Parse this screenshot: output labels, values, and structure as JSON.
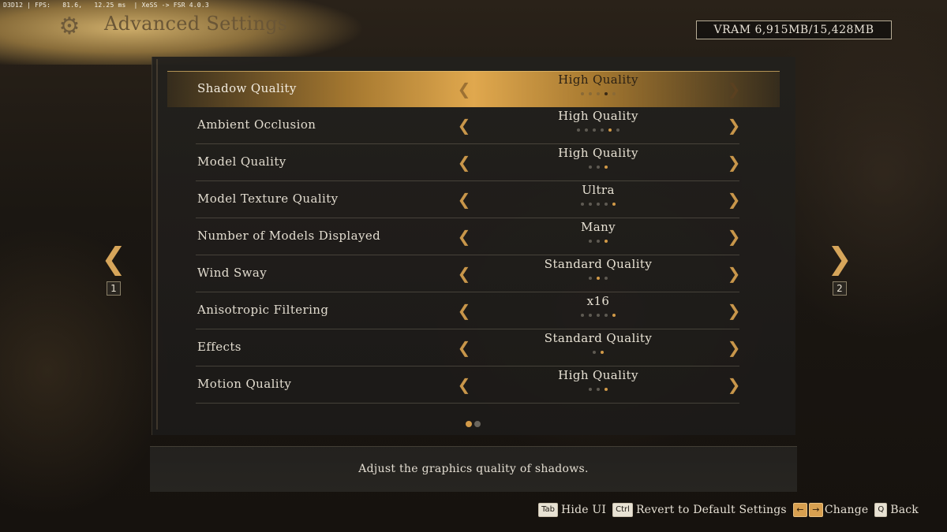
{
  "hud": {
    "text": "D3D12 | FPS:   81.6,   12.25 ms  | XeSS -> FSR 4.0.3"
  },
  "header": {
    "title": "Advanced Settings",
    "icon": "gear-icon"
  },
  "vram": {
    "text": "VRAM 6,915MB/15,428MB"
  },
  "settings": [
    {
      "label": "Shadow Quality",
      "value": "High Quality",
      "levels": 5,
      "current": 4,
      "selected": true
    },
    {
      "label": "Ambient Occlusion",
      "value": "High Quality",
      "levels": 6,
      "current": 5
    },
    {
      "label": "Model Quality",
      "value": "High Quality",
      "levels": 3,
      "current": 3
    },
    {
      "label": "Model Texture Quality",
      "value": "Ultra",
      "levels": 5,
      "current": 5
    },
    {
      "label": "Number of Models Displayed",
      "value": "Many",
      "levels": 3,
      "current": 3
    },
    {
      "label": "Wind Sway",
      "value": "Standard Quality",
      "levels": 3,
      "current": 2
    },
    {
      "label": "Anisotropic Filtering",
      "value": "x16",
      "levels": 5,
      "current": 5
    },
    {
      "label": "Effects",
      "value": "Standard Quality",
      "levels": 2,
      "current": 2
    },
    {
      "label": "Motion Quality",
      "value": "High Quality",
      "levels": 3,
      "current": 3
    }
  ],
  "pagination": {
    "pages": 2,
    "current": 1
  },
  "nav": {
    "prev_key": "1",
    "next_key": "2"
  },
  "description": "Adjust the graphics quality of shadows.",
  "hints": {
    "tab_key": "Tab",
    "tab_label": "Hide UI",
    "ctrl_key": "Ctrl",
    "ctrl_label": "Revert to Default Settings",
    "change_left": "←",
    "change_right": "→",
    "change_label": "Change",
    "back_key": "Q",
    "back_label": "Back"
  },
  "colors": {
    "accent": "#d29a48",
    "selected_row": "#e0a84e",
    "panel": "#22201d"
  }
}
